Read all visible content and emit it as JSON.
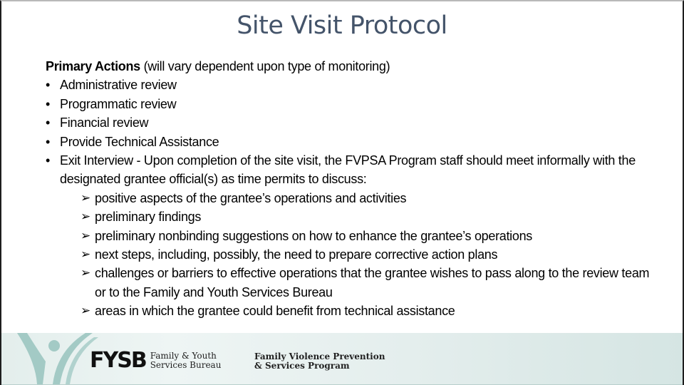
{
  "slide": {
    "title": "Site Visit Protocol",
    "heading_bold": "Primary Actions",
    "heading_rest": " (will vary dependent upon type of monitoring)",
    "bullet_glyph": "•",
    "arrow_glyph": "➢",
    "bullets": [
      "Administrative review",
      "Programmatic review",
      "Financial review",
      "Provide Technical Assistance",
      "Exit Interview - Upon completion of the site visit, the FVPSA Program staff should meet informally with the designated grantee official(s) as time permits to discuss:"
    ],
    "sub_bullets": [
      "positive aspects of the grantee’s operations and activities",
      "preliminary findings",
      "preliminary nonbinding suggestions on how to enhance the grantee’s operations",
      "next steps, including, possibly, the need to prepare corrective action plans",
      "challenges or barriers to effective operations that the grantee wishes to pass along to the review team or to the Family and Youth Services Bureau",
      "areas in which the grantee could benefit from technical assistance"
    ]
  },
  "footer": {
    "fysb_mark": "FYSB",
    "fysb_line1": "Family & Youth",
    "fysb_line2": "Services Bureau",
    "program_line1": "Family Violence Prevention",
    "program_line2": "& Services Program",
    "colors": {
      "figure": "#9fc7c2",
      "background": "#e4eeed"
    }
  }
}
